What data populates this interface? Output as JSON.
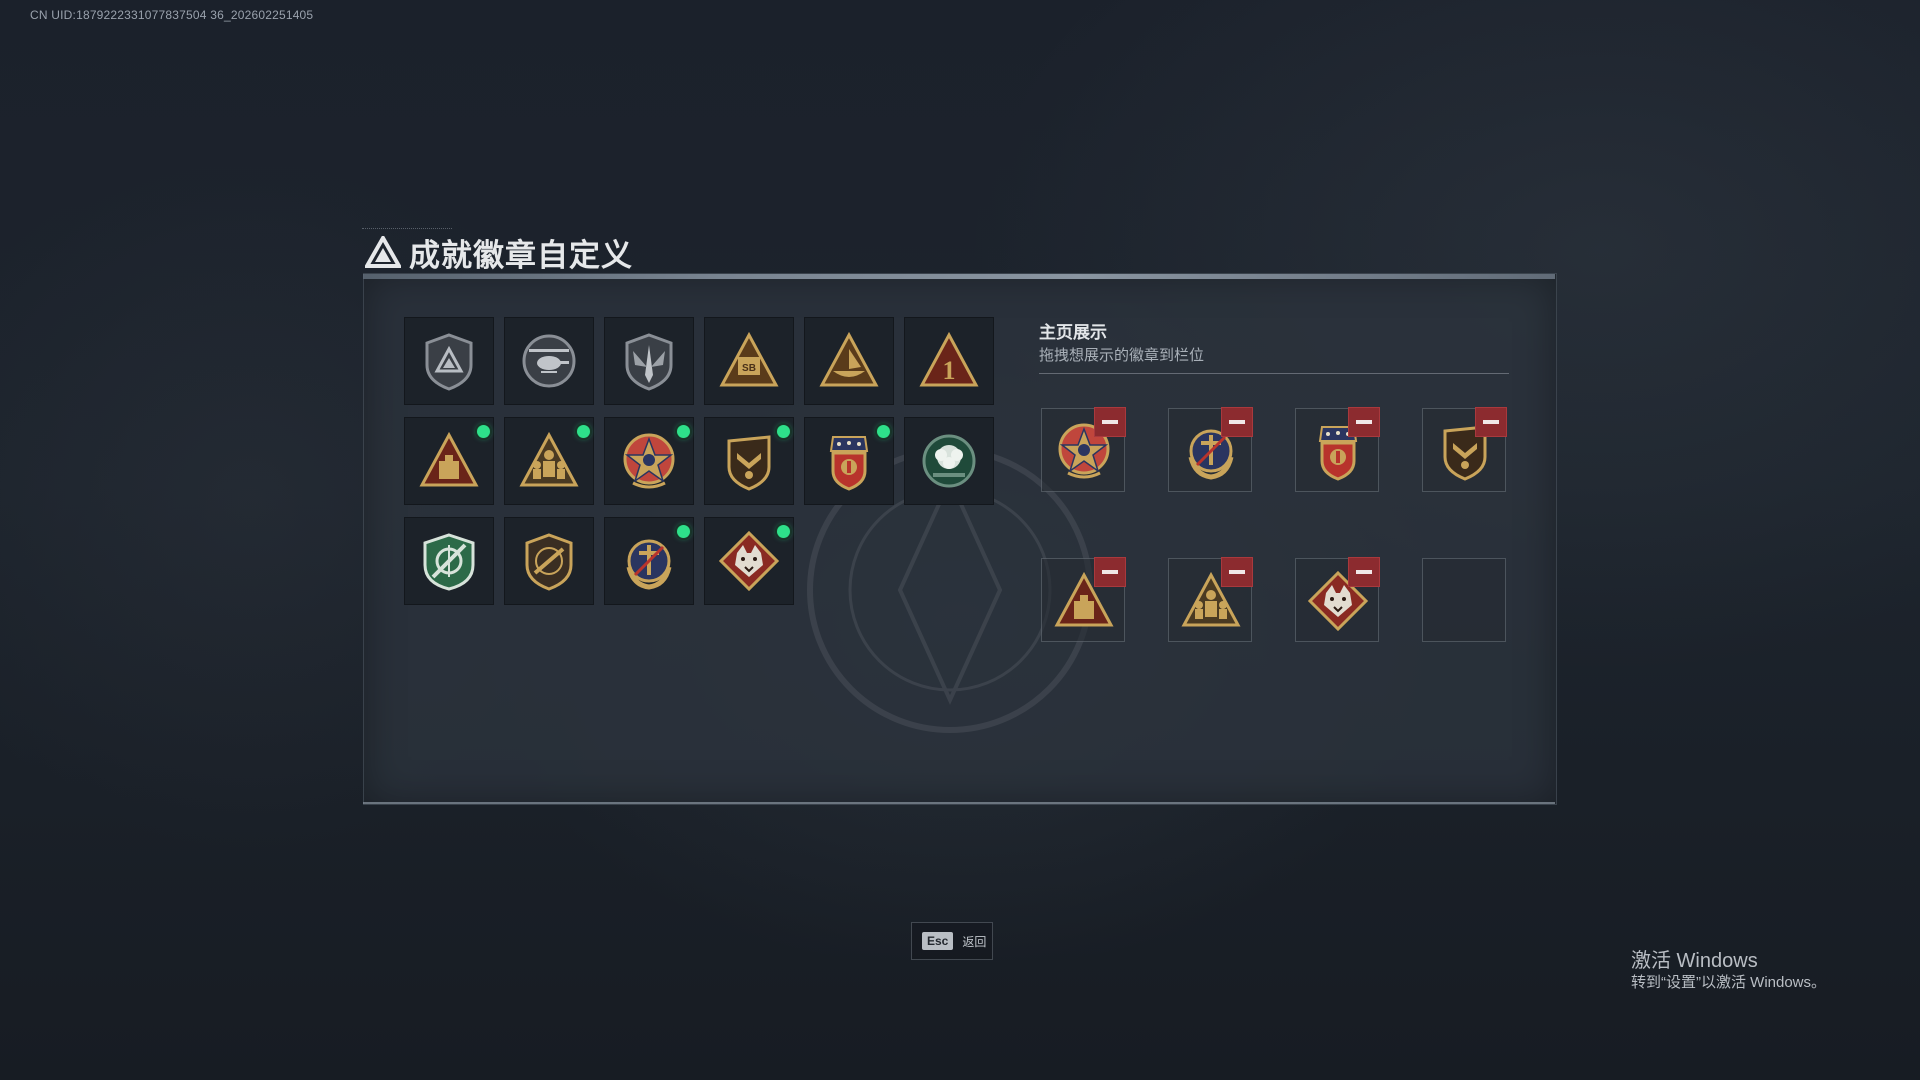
{
  "uid_text": "CN UID:1879222331077837504 36_202602251405",
  "title": "成就徽章自定义",
  "showcase": {
    "heading": "主页展示",
    "subtitle": "拖拽想展示的徽章到栏位"
  },
  "badges": [
    {
      "name": "triangle-shield-badge",
      "is_new": false
    },
    {
      "name": "helicopter-badge",
      "is_new": false
    },
    {
      "name": "wing-shield-badge",
      "is_new": false
    },
    {
      "name": "sb-triangle-badge",
      "is_new": false
    },
    {
      "name": "boat-triangle-badge",
      "is_new": false
    },
    {
      "name": "number-one-triangle-badge",
      "is_new": false
    },
    {
      "name": "crate-triangle-badge",
      "is_new": true
    },
    {
      "name": "soldiers-triangle-badge",
      "is_new": true
    },
    {
      "name": "star-medal-badge",
      "is_new": true
    },
    {
      "name": "chevron-shield-badge",
      "is_new": true
    },
    {
      "name": "eagle-crest-badge",
      "is_new": true
    },
    {
      "name": "green-flower-badge",
      "is_new": false
    },
    {
      "name": "green-shield-badge",
      "is_new": false
    },
    {
      "name": "rifle-shield-badge",
      "is_new": false
    },
    {
      "name": "anchor-wreath-badge",
      "is_new": true
    },
    {
      "name": "wolf-diamond-badge",
      "is_new": true
    }
  ],
  "showcase_slots": [
    {
      "badge": "star-medal-badge"
    },
    {
      "badge": "anchor-wreath-badge"
    },
    {
      "badge": "eagle-crest-badge"
    },
    {
      "badge": "chevron-shield-badge"
    },
    {
      "badge": "crate-triangle-badge"
    },
    {
      "badge": "soldiers-triangle-badge"
    },
    {
      "badge": "wolf-diamond-badge"
    },
    {
      "badge": ""
    }
  ],
  "esc_key": "Esc",
  "esc_label": "返回",
  "windows_notice": {
    "title": "激活 Windows",
    "subtitle": "转到“设置”以激活 Windows。"
  },
  "colors": {
    "gold": "#c9a45a",
    "dark_gold": "#7a5d2a",
    "new_dot": "#2ee08a",
    "remove_red": "#8c2b2f"
  }
}
